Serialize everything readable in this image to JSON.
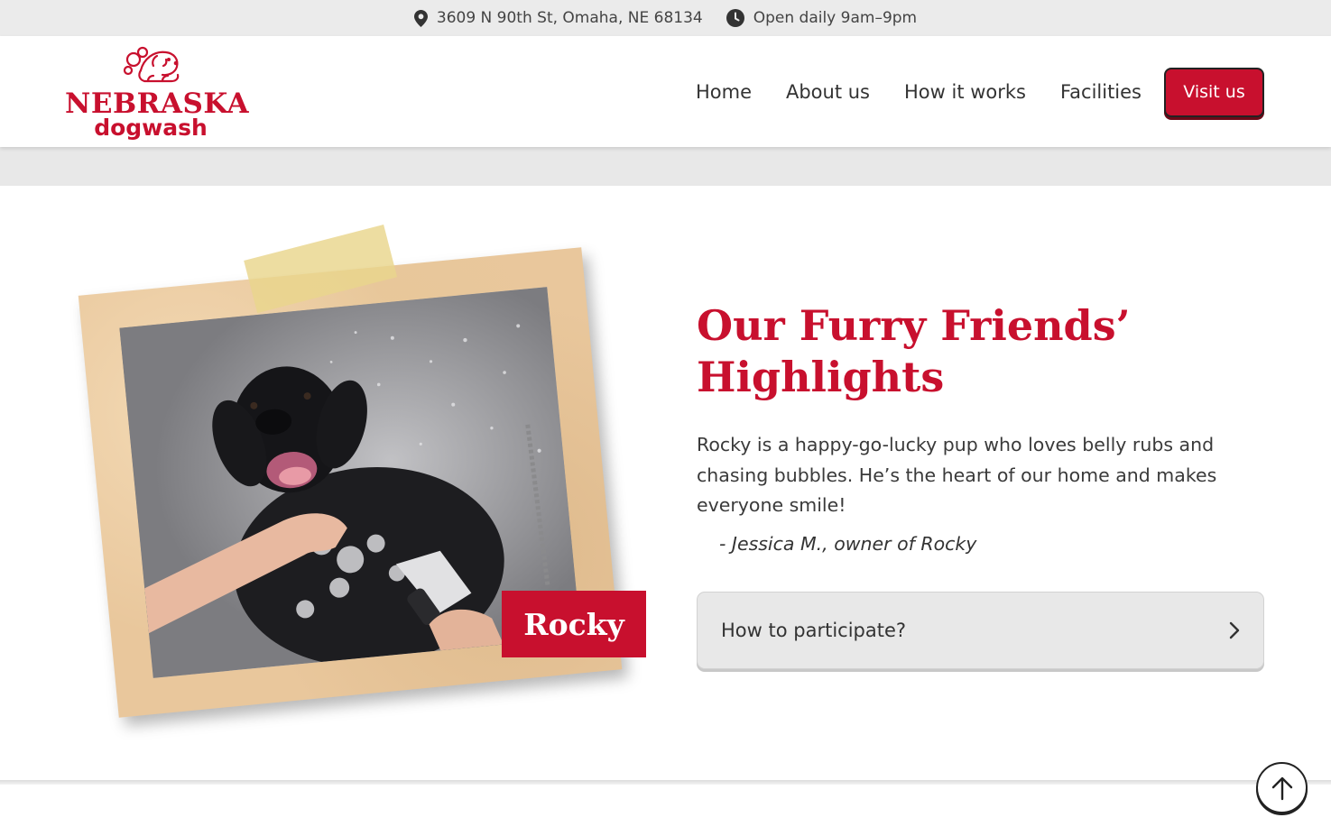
{
  "topbar": {
    "address": "3609 N 90th St, Omaha, NE 68134",
    "hours": "Open daily 9am–9pm"
  },
  "logo": {
    "line1": "NEBRASKA",
    "line2": "dogwash"
  },
  "nav": {
    "items": [
      {
        "label": "Home"
      },
      {
        "label": "About us"
      },
      {
        "label": "How it works"
      },
      {
        "label": "Facilities"
      }
    ],
    "cta": "Visit us"
  },
  "highlight": {
    "pet_name": "Rocky",
    "title": "Our Furry Friends’ Highlights",
    "description": "Rocky is a happy-go-lucky pup who loves belly rubs and chasing bubbles. He’s the heart of our home and makes everyone smile!",
    "quote": "- Jessica M., owner of Rocky",
    "accordion_label": "How to participate?"
  },
  "colors": {
    "brand_red": "#c8102e",
    "frame_tan": "#e9c79c",
    "band_grey": "#e8e8e8"
  }
}
